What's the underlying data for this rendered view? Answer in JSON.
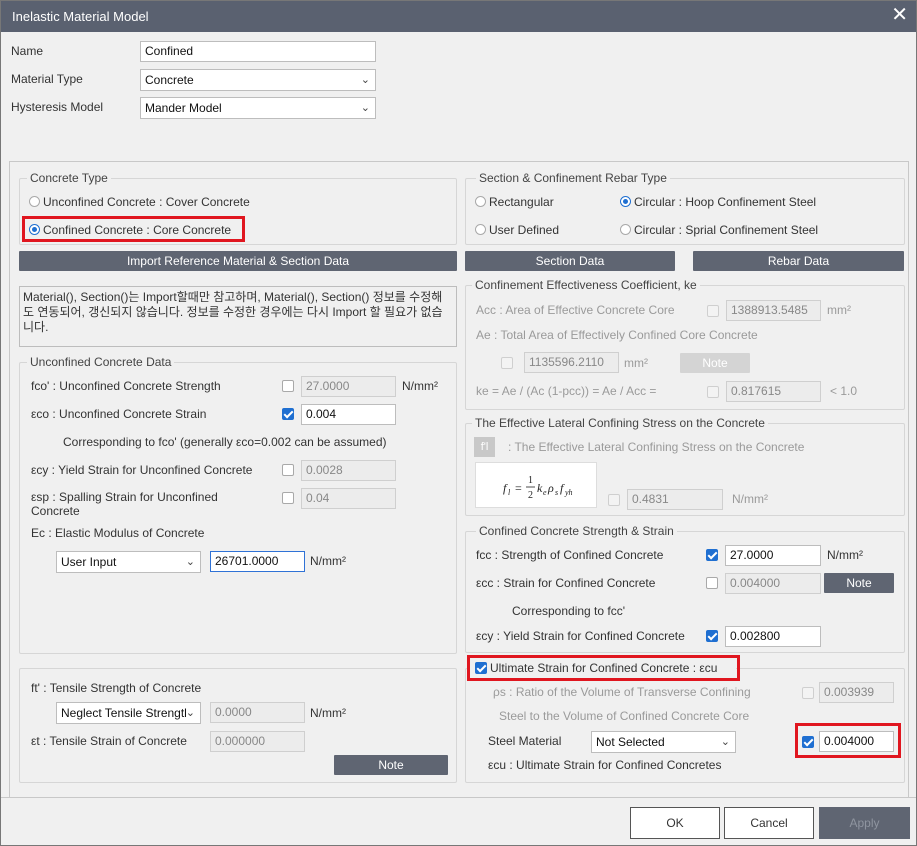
{
  "title": "Inelastic Material Model",
  "close": "✕",
  "top": {
    "name_label": "Name",
    "name_value": "Confined",
    "mattype_label": "Material Type",
    "mattype_value": "Concrete",
    "hyst_label": "Hysteresis Model",
    "hyst_value": "Mander Model"
  },
  "concrete_type": {
    "title": "Concrete Type",
    "opt1": "Unconfined Concrete : Cover Concrete",
    "opt2": "Confined Concrete : Core Concrete"
  },
  "section_type": {
    "title": "Section & Confinement Rebar Type",
    "rect": "Rectangular",
    "circ_hoop": "Circular : Hoop Confinement Steel",
    "user": "User Defined",
    "circ_spiral": "Circular : Sprial Confinement Steel"
  },
  "buttons": {
    "import": "Import Reference Material & Section Data",
    "section": "Section Data",
    "rebar": "Rebar Data",
    "note": "Note",
    "ok": "OK",
    "cancel": "Cancel",
    "apply": "Apply"
  },
  "info_text": "Material(), Section()는 Import할때만 참고하며, Material(), Section() 정보를 수정해도 연동되어, 갱신되지 않습니다. 정보를 수정한 경우에는 다시 Import 할 필요가 없습니다.",
  "unconfined": {
    "title": "Unconfined Concrete Data",
    "fco_label": "fco' : Unconfined Concrete Strength",
    "fco_value": "27.0000",
    "fco_unit": "N/mm²",
    "eco_label": "εco : Unconfined Concrete Strain",
    "eco_value": "0.004",
    "eco_note": "Corresponding to fco' (generally εco=0.002 can be assumed)",
    "ecy_label": "εcy : Yield Strain for Unconfined Concrete",
    "ecy_value": "0.0028",
    "esp_label": "εsp : Spalling Strain for Unconfined Concrete",
    "esp_value": "0.04",
    "ec_label": "Ec : Elastic Modulus of Concrete",
    "ec_mode": "User Input",
    "ec_value": "26701.0000",
    "ec_unit": "N/mm²"
  },
  "tensile": {
    "ft_label": "ft' : Tensile Strength of Concrete",
    "ft_mode": "Neglect Tensile Strength",
    "ft_value": "0.0000",
    "ft_unit": "N/mm²",
    "et_label": "εt : Tensile Strain of Concrete",
    "et_value": "0.000000"
  },
  "ke": {
    "title": "Confinement Effectiveness Coefficient, ke",
    "acc_label": "Acc : Area of Effective Concrete Core",
    "acc_value": "1388913.5485",
    "acc_unit": "mm²",
    "ae_label": "Ae : Total Area of Effectively Confined Core Concrete",
    "ae_value": "1135596.2110",
    "ae_unit": "mm²",
    "ke_label": "ke = Ae / (Ac (1-pcc)) = Ae / Acc =",
    "ke_value": "0.817615",
    "ke_limit": "< 1.0"
  },
  "lateral": {
    "title": "The Effective Lateral Confining Stress on the Concrete",
    "fl_badge": "f'l",
    "fl_label": ": The Effective Lateral Confining Stress on the Concrete",
    "fl_value": "0.4831",
    "fl_unit": "N/mm²"
  },
  "confined": {
    "title": "Confined Concrete Strength & Strain",
    "fcc_label": "fcc : Strength of Confined Concrete",
    "fcc_value": "27.0000",
    "fcc_unit": "N/mm²",
    "ecc_label": "εcc : Strain for Confined Concrete",
    "ecc_value": "0.004000",
    "ecc_note": "Corresponding to fcc'",
    "ecy_label": "εcy : Yield Strain for Confined Concrete",
    "ecy_value": "0.002800"
  },
  "ultimate": {
    "title": "Ultimate Strain for Confined Concrete : εcu",
    "ps_label1": "ρs : Ratio of the Volume of Transverse Confining",
    "ps_label2": "Steel  to the Volume of Confined Concrete Core",
    "ps_value": "0.003939",
    "steel_label": "Steel Material",
    "steel_value": "Not Selected",
    "ecu_value": "0.004000",
    "ecu_label": "εcu : Ultimate Strain for Confined Concretes"
  },
  "colors": {
    "accent": "#1f6fd1",
    "highlight": "#e0161f",
    "titlebar": "#5a6170",
    "button": "#5f6572"
  }
}
